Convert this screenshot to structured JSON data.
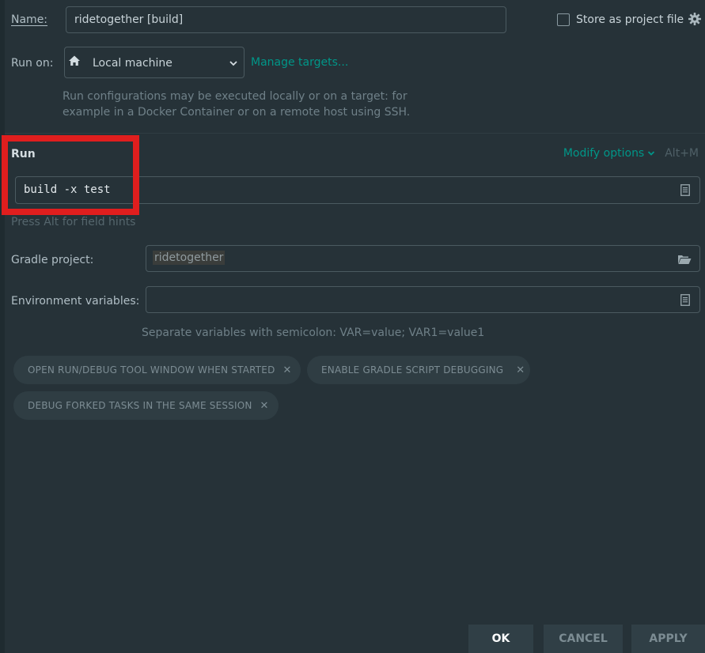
{
  "name": {
    "label": "Name:",
    "value": "ridetogether [build]"
  },
  "store_as_project_file": {
    "label": "Store as project file",
    "checked": false
  },
  "run_on": {
    "label": "Run on:",
    "selected": "Local machine",
    "manage_link": "Manage targets...",
    "description_line1": "Run configurations may be executed locally or on a target: for",
    "description_line2": "example in a Docker Container or on a remote host using SSH."
  },
  "run_section": {
    "title": "Run",
    "modify_options": "Modify options",
    "shortcut": "Alt+M",
    "command": "build -x test",
    "field_hint": "Press Alt for field hints"
  },
  "gradle_project": {
    "label": "Gradle project:",
    "value": "ridetogether"
  },
  "environment_variables": {
    "label": "Environment variables:",
    "value": "",
    "hint": "Separate variables with semicolon: VAR=value; VAR1=value1"
  },
  "option_chips": [
    "OPEN RUN/DEBUG TOOL WINDOW WHEN STARTED",
    "ENABLE GRADLE SCRIPT DEBUGGING",
    "DEBUG FORKED TASKS IN THE SAME SESSION"
  ],
  "buttons": {
    "ok": "OK",
    "cancel": "CANCEL",
    "apply": "APPLY"
  },
  "colors": {
    "background": "#263238",
    "accent": "#009688",
    "highlight": "#e01e1e"
  }
}
